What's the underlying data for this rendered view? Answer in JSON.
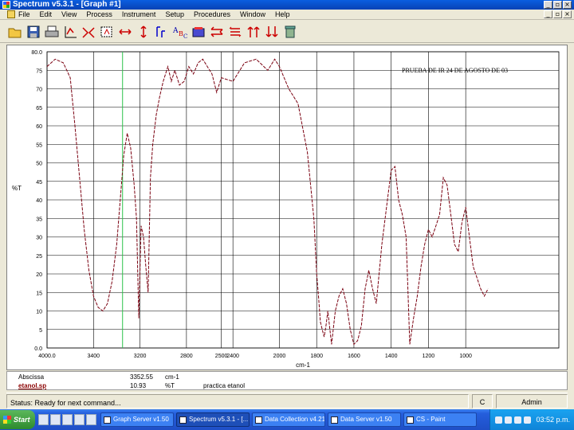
{
  "window": {
    "title": "Spectrum v5.3.1 - [Graph #1]",
    "controls": [
      "_",
      "▫",
      "×"
    ],
    "mdi_controls": [
      "_",
      "▫",
      "×"
    ]
  },
  "menu": [
    "File",
    "Edit",
    "View",
    "Process",
    "Instrument",
    "Setup",
    "Procedures",
    "Window",
    "Help"
  ],
  "toolbar_icons": [
    "open-folder-icon",
    "save-disk-icon",
    "print-icon",
    "scale-xy-icon",
    "abex-icon",
    "select-region-icon",
    "expand-x-icon",
    "expand-y-icon",
    "peak-label-icon",
    "text-label-icon",
    "library-icon",
    "shift-h-icon",
    "shift-v-icon",
    "offset-up-icon",
    "offset-down-icon",
    "recycle-icon"
  ],
  "chart_data": {
    "type": "line",
    "annotation": "PRUEBA DE IR 24 DE AGOSTO DE 03",
    "xlabel": "cm-1",
    "ylabel": "%T",
    "xlim": [
      4000,
      2500
    ],
    "x_scale": "ir-split",
    "ylim": [
      0,
      80
    ],
    "x_ticks": [
      {
        "value": 4000,
        "label": "4000.0"
      },
      {
        "value": 3600,
        "label": "3400"
      },
      {
        "value": 3200,
        "label": "3200"
      },
      {
        "value": 2800,
        "label": "2800"
      },
      {
        "value": 2400,
        "label": "2400"
      },
      {
        "value": 2000,
        "label": "2000"
      },
      {
        "value": 1800,
        "label": "1800"
      },
      {
        "value": 1600,
        "label": "1600"
      },
      {
        "value": 1400,
        "label": "1400"
      },
      {
        "value": 1200,
        "label": "1200"
      },
      {
        "value": 1000,
        "label": "1000"
      },
      {
        "value": 2500,
        "label": "2500"
      }
    ],
    "y_ticks": [
      {
        "value": 80,
        "label": "80.0"
      },
      {
        "value": 75,
        "label": "75"
      },
      {
        "value": 70,
        "label": "70"
      },
      {
        "value": 65,
        "label": "65"
      },
      {
        "value": 60,
        "label": "60"
      },
      {
        "value": 55,
        "label": "55"
      },
      {
        "value": 50,
        "label": "50"
      },
      {
        "value": 45,
        "label": "45"
      },
      {
        "value": 40,
        "label": "40"
      },
      {
        "value": 35,
        "label": "35"
      },
      {
        "value": 30,
        "label": "30"
      },
      {
        "value": 25,
        "label": "25"
      },
      {
        "value": 20,
        "label": "20"
      },
      {
        "value": 15,
        "label": "15"
      },
      {
        "value": 10,
        "label": "10"
      },
      {
        "value": 5,
        "label": "5"
      },
      {
        "value": 0,
        "label": "0.0"
      }
    ],
    "grid": true,
    "cursor_x": 3350,
    "series": [
      {
        "color": "#7a0010",
        "points": [
          [
            4000,
            76
          ],
          [
            3930,
            78
          ],
          [
            3860,
            77
          ],
          [
            3800,
            73
          ],
          [
            3760,
            60
          ],
          [
            3720,
            46
          ],
          [
            3680,
            32
          ],
          [
            3640,
            21
          ],
          [
            3600,
            14
          ],
          [
            3560,
            11
          ],
          [
            3520,
            10
          ],
          [
            3480,
            12
          ],
          [
            3440,
            18
          ],
          [
            3400,
            28
          ],
          [
            3370,
            40
          ],
          [
            3340,
            52
          ],
          [
            3310,
            58
          ],
          [
            3280,
            54
          ],
          [
            3250,
            44
          ],
          [
            3230,
            35
          ],
          [
            3210,
            8
          ],
          [
            3190,
            33
          ],
          [
            3170,
            30
          ],
          [
            3150,
            22
          ],
          [
            3130,
            15
          ],
          [
            3110,
            46
          ],
          [
            3090,
            55
          ],
          [
            3060,
            63
          ],
          [
            3030,
            68
          ],
          [
            3000,
            72
          ],
          [
            2960,
            76
          ],
          [
            2930,
            72
          ],
          [
            2900,
            75
          ],
          [
            2860,
            71
          ],
          [
            2820,
            72
          ],
          [
            2780,
            76
          ],
          [
            2740,
            74
          ],
          [
            2700,
            77
          ],
          [
            2660,
            78
          ],
          [
            2620,
            76
          ],
          [
            2580,
            74
          ],
          [
            2540,
            69
          ],
          [
            2500,
            73
          ],
          [
            2400,
            72
          ],
          [
            2300,
            77
          ],
          [
            2200,
            78
          ],
          [
            2100,
            75
          ],
          [
            2040,
            78
          ],
          [
            2000,
            76
          ],
          [
            1950,
            70
          ],
          [
            1900,
            66
          ],
          [
            1850,
            53
          ],
          [
            1815,
            35
          ],
          [
            1800,
            20
          ],
          [
            1790,
            14
          ],
          [
            1780,
            7
          ],
          [
            1770,
            5
          ],
          [
            1760,
            3
          ],
          [
            1750,
            6
          ],
          [
            1740,
            10
          ],
          [
            1720,
            1
          ],
          [
            1700,
            10
          ],
          [
            1680,
            14
          ],
          [
            1660,
            16
          ],
          [
            1640,
            12
          ],
          [
            1620,
            5
          ],
          [
            1600,
            1
          ],
          [
            1580,
            2
          ],
          [
            1560,
            6
          ],
          [
            1540,
            16
          ],
          [
            1520,
            21
          ],
          [
            1500,
            16
          ],
          [
            1480,
            12
          ],
          [
            1450,
            28
          ],
          [
            1420,
            40
          ],
          [
            1400,
            48
          ],
          [
            1380,
            49
          ],
          [
            1360,
            40
          ],
          [
            1340,
            36
          ],
          [
            1320,
            30
          ],
          [
            1300,
            1
          ],
          [
            1280,
            8
          ],
          [
            1260,
            14
          ],
          [
            1240,
            22
          ],
          [
            1220,
            28
          ],
          [
            1200,
            32
          ],
          [
            1180,
            30
          ],
          [
            1160,
            33
          ],
          [
            1140,
            36
          ],
          [
            1120,
            46
          ],
          [
            1100,
            44
          ],
          [
            1080,
            36
          ],
          [
            1060,
            28
          ],
          [
            1040,
            26
          ],
          [
            1020,
            34
          ],
          [
            1000,
            38
          ],
          [
            980,
            30
          ],
          [
            960,
            22
          ],
          [
            940,
            19
          ],
          [
            920,
            16
          ],
          [
            900,
            14
          ],
          [
            880,
            16
          ]
        ]
      }
    ]
  },
  "peak_table": {
    "rows": [
      {
        "name": "Abscissa",
        "value": "3352.55",
        "unit": "cm-1",
        "note": ""
      },
      {
        "name": "etanol.sp",
        "value": "10.93",
        "unit": "%T",
        "note": "practica etanol"
      }
    ]
  },
  "status": {
    "text": "Status: Ready for next command...",
    "mode": "C",
    "user": "Admin"
  },
  "taskbar": {
    "start_label": "Start",
    "tasks": [
      {
        "label": "Graph Server v1.50",
        "active": false
      },
      {
        "label": "Spectrum v5.3.1 - [...",
        "active": true
      },
      {
        "label": "Data Collection v4.21",
        "active": false
      },
      {
        "label": "Data Server v1.50",
        "active": false
      },
      {
        "label": "CS - Paint",
        "active": false
      }
    ],
    "clock": "03:52 p.m."
  }
}
